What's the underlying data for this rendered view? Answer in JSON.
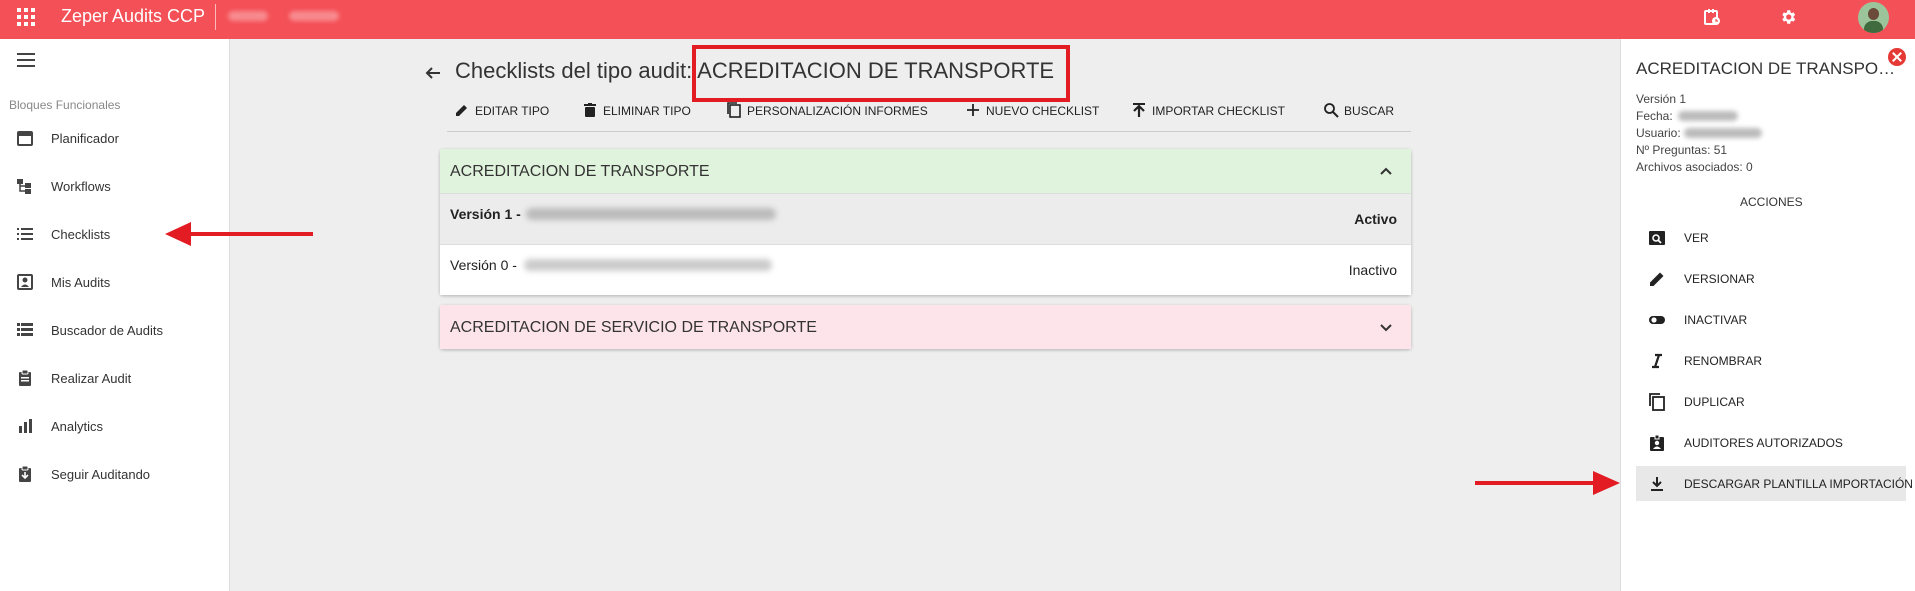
{
  "header": {
    "app_title": "Zeper Audits CCP"
  },
  "sidebar": {
    "section_label": "Bloques Funcionales",
    "items": [
      {
        "label": "Planificador",
        "icon": "calendar-icon"
      },
      {
        "label": "Workflows",
        "icon": "workflow-icon"
      },
      {
        "label": "Checklists",
        "icon": "list-icon"
      },
      {
        "label": "Mis Audits",
        "icon": "account-box-icon"
      },
      {
        "label": "Buscador de Audits",
        "icon": "view-list-icon"
      },
      {
        "label": "Realizar Audit",
        "icon": "clipboard-icon"
      },
      {
        "label": "Analytics",
        "icon": "bar-chart-icon"
      },
      {
        "label": "Seguir Auditando",
        "icon": "clipboard-arrow-icon"
      }
    ]
  },
  "main": {
    "title_prefix": "Checklists del tipo audit:",
    "title_type": "ACREDITACION DE TRANSPORTE",
    "toolbar": {
      "edit": "EDITAR TIPO",
      "delete": "ELIMINAR TIPO",
      "custom_reports": "PERSONALIZACIÓN INFORMES",
      "new_checklist": "NUEVO CHECKLIST",
      "import_checklist": "IMPORTAR CHECKLIST",
      "search": "BUSCAR"
    },
    "checklists": [
      {
        "name": "ACREDITACION DE TRANSPORTE",
        "header_color": "#e0f3dc",
        "expanded": true,
        "versions": [
          {
            "label": "Versión 1 -",
            "status": "Activo"
          },
          {
            "label": "Versión 0 -",
            "status": "Inactivo"
          }
        ]
      },
      {
        "name": "ACREDITACION DE SERVICIO DE TRANSPORTE",
        "header_color": "#fde4ea",
        "expanded": false
      }
    ]
  },
  "panel": {
    "title": "ACREDITACION DE TRANSPORTE",
    "version": "Versión 1",
    "fecha_label": "Fecha:",
    "usuario_label": "Usuario:",
    "preguntas": "Nº Preguntas: 51",
    "archivos": "Archivos asociados: 0",
    "actions_title": "ACCIONES",
    "actions": [
      {
        "label": "VER",
        "icon": "preview-icon"
      },
      {
        "label": "VERSIONAR",
        "icon": "pencil-icon"
      },
      {
        "label": "INACTIVAR",
        "icon": "toggle-icon"
      },
      {
        "label": "RENOMBRAR",
        "icon": "italic-icon"
      },
      {
        "label": "DUPLICAR",
        "icon": "copy-icon"
      },
      {
        "label": "AUDITORES AUTORIZADOS",
        "icon": "badge-icon"
      },
      {
        "label": "DESCARGAR PLANTILLA IMPORTACIÓN",
        "icon": "download-icon"
      }
    ]
  },
  "colors": {
    "topbar": "#f45057",
    "annotation_red": "#e21c22"
  }
}
